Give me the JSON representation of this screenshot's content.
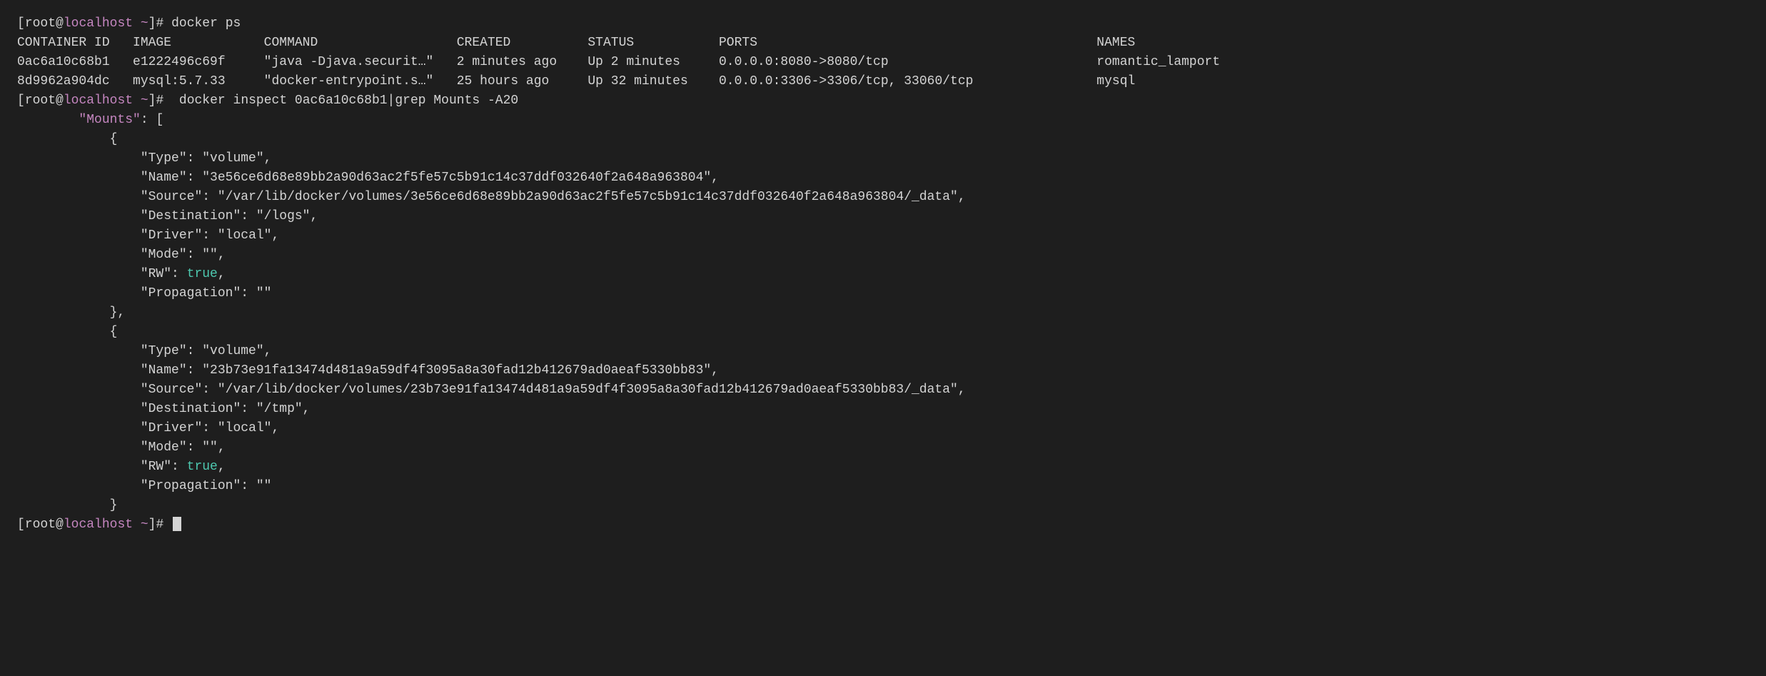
{
  "terminal": {
    "lines": [
      {
        "id": "cmd-docker-ps",
        "type": "command",
        "prompt": "[root@localhost ~]#",
        "command": " docker ps"
      },
      {
        "id": "table-header",
        "type": "header",
        "content": "CONTAINER ID   IMAGE            COMMAND                  CREATED          STATUS           PORTS                                            NAMES"
      },
      {
        "id": "row1",
        "type": "tablerow",
        "container_id": "0ac6a10c68b1",
        "image": "e1222496c69f",
        "command": "\"java -Djava.securit…\"",
        "created": "2 minutes ago",
        "status": "Up 2 minutes",
        "ports": "0.0.0.0:8080->8080/tcp",
        "names": "romantic_lamport"
      },
      {
        "id": "row2",
        "type": "tablerow",
        "container_id": "8d9962a904dc",
        "image": "mysql:5.7.33",
        "command": "\"docker-entrypoint.s…\"",
        "created": "25 hours ago",
        "status": "Up 32 minutes",
        "ports": "0.0.0.0:3306->3306/tcp, 33060/tcp",
        "names": "mysql"
      },
      {
        "id": "cmd-docker-inspect",
        "type": "command",
        "prompt": "[root@localhost ~]#",
        "command": "  docker inspect 0ac6a10c68b1|grep Mounts -A20"
      },
      {
        "id": "json-mounts-open",
        "type": "jsonline",
        "indent": "        ",
        "content": "\"Mounts\": ["
      },
      {
        "id": "json-brace1-open",
        "type": "jsonline",
        "indent": "            ",
        "content": "{"
      },
      {
        "id": "json-type1",
        "type": "jsonkv",
        "indent": "                ",
        "key": "\"Type\"",
        "value": "\"volume\","
      },
      {
        "id": "json-name1",
        "type": "jsonkv",
        "indent": "                ",
        "key": "\"Name\"",
        "value": "\"3e56ce6d68e89bb2a90d63ac2f5fe57c5b91c14c37ddf032640f2a648a963804\","
      },
      {
        "id": "json-source1",
        "type": "jsonkv",
        "indent": "                ",
        "key": "\"Source\"",
        "value": "\"/var/lib/docker/volumes/3e56ce6d68e89bb2a90d63ac2f5fe57c5b91c14c37ddf032640f2a648a963804/_data\","
      },
      {
        "id": "json-dest1",
        "type": "jsonkv",
        "indent": "                ",
        "key": "\"Destination\"",
        "value": "\"/logs\","
      },
      {
        "id": "json-driver1",
        "type": "jsonkv",
        "indent": "                ",
        "key": "\"Driver\"",
        "value": "\"local\","
      },
      {
        "id": "json-mode1",
        "type": "jsonkv",
        "indent": "                ",
        "key": "\"Mode\"",
        "value": "\"\","
      },
      {
        "id": "json-rw1",
        "type": "jsonkvbool",
        "indent": "                ",
        "key": "\"RW\"",
        "bool_value": "true",
        "suffix": ","
      },
      {
        "id": "json-prop1",
        "type": "jsonkv",
        "indent": "                ",
        "key": "\"Propagation\"",
        "value": "\"\""
      },
      {
        "id": "json-brace1-close",
        "type": "jsonline",
        "indent": "            ",
        "content": "},"
      },
      {
        "id": "json-brace2-open",
        "type": "jsonline",
        "indent": "            ",
        "content": "{"
      },
      {
        "id": "json-type2",
        "type": "jsonkv",
        "indent": "                ",
        "key": "\"Type\"",
        "value": "\"volume\","
      },
      {
        "id": "json-name2",
        "type": "jsonkv",
        "indent": "                ",
        "key": "\"Name\"",
        "value": "\"23b73e91fa13474d481a9a59df4f3095a8a30fad12b412679ad0aeaf5330bb83\","
      },
      {
        "id": "json-source2",
        "type": "jsonkv",
        "indent": "                ",
        "key": "\"Source\"",
        "value": "\"/var/lib/docker/volumes/23b73e91fa13474d481a9a59df4f3095a8a30fad12b412679ad0aeaf5330bb83/_data\","
      },
      {
        "id": "json-dest2",
        "type": "jsonkv",
        "indent": "                ",
        "key": "\"Destination\"",
        "value": "\"/tmp\","
      },
      {
        "id": "json-driver2",
        "type": "jsonkv",
        "indent": "                ",
        "key": "\"Driver\"",
        "value": "\"local\","
      },
      {
        "id": "json-mode2",
        "type": "jsonkv",
        "indent": "                ",
        "key": "\"Mode\"",
        "value": "\"\","
      },
      {
        "id": "json-rw2",
        "type": "jsonkvbool",
        "indent": "                ",
        "key": "\"RW\"",
        "bool_value": "true",
        "suffix": ","
      },
      {
        "id": "json-prop2",
        "type": "jsonkv",
        "indent": "                ",
        "key": "\"Propagation\"",
        "value": "\"\""
      },
      {
        "id": "json-brace2-close",
        "type": "jsonline",
        "indent": "            ",
        "content": "}"
      },
      {
        "id": "cmd-final-prompt",
        "type": "prompt-only",
        "prompt": "[root@localhost ~]#"
      }
    ],
    "colors": {
      "background": "#1e1e1e",
      "default_text": "#d4d4d4",
      "prompt_root": "#d4d4d4",
      "prompt_host": "#c586c0",
      "json_bool": "#4ec9b0",
      "mounts_key": "#c586c0"
    }
  }
}
